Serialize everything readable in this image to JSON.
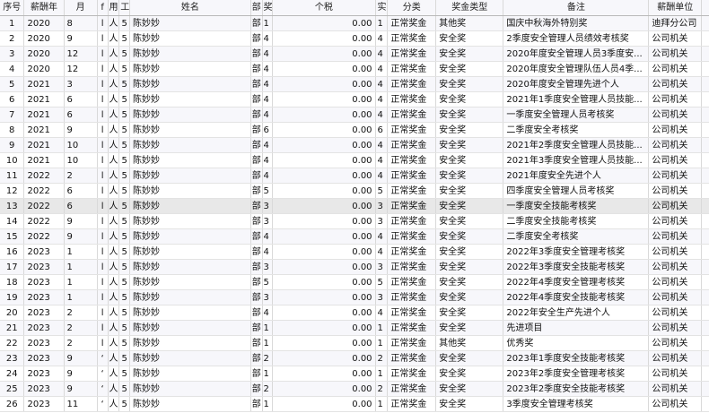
{
  "headers": [
    "序号",
    "薪酬年",
    "月",
    "f",
    "用",
    "工",
    "姓名",
    "部",
    "奖",
    "个税",
    "实",
    "分类",
    "奖金类型",
    "备注",
    "薪酬单位"
  ],
  "rows": [
    [
      "1",
      "2020",
      "8",
      "l",
      "人",
      "5",
      "陈妙妙",
      "部",
      "1",
      "0.00",
      "1",
      "正常奖金",
      "其他奖",
      "国庆中秋海外特别奖",
      "迪拜分公司"
    ],
    [
      "2",
      "2020",
      "9",
      "l",
      "人",
      "5",
      "陈妙妙",
      "部",
      "4",
      "0.00",
      "4",
      "正常奖金",
      "安全奖",
      "2季度安全管理人员绩效考核奖",
      "公司机关"
    ],
    [
      "3",
      "2020",
      "12",
      "l",
      "人",
      "5",
      "陈妙妙",
      "部",
      "4",
      "0.00",
      "4",
      "正常奖金",
      "安全奖",
      "2020年度安全管理人员3季度安...",
      "公司机关"
    ],
    [
      "4",
      "2020",
      "12",
      "l",
      "人",
      "5",
      "陈妙妙",
      "部",
      "4",
      "0.00",
      "4",
      "正常奖金",
      "安全奖",
      "2020年度安全管理队伍人员4季...",
      "公司机关"
    ],
    [
      "5",
      "2021",
      "3",
      "l",
      "人",
      "5",
      "陈妙妙",
      "部",
      "4",
      "0.00",
      "4",
      "正常奖金",
      "安全奖",
      "2020年度安全管理先进个人",
      "公司机关"
    ],
    [
      "6",
      "2021",
      "6",
      "l",
      "人",
      "5",
      "陈妙妙",
      "部",
      "4",
      "0.00",
      "4",
      "正常奖金",
      "安全奖",
      "2021年1季度安全管理人员技能...",
      "公司机关"
    ],
    [
      "7",
      "2021",
      "6",
      "l",
      "人",
      "5",
      "陈妙妙",
      "部",
      "4",
      "0.00",
      "4",
      "正常奖金",
      "安全奖",
      "一季度安全管理人员考核奖",
      "公司机关"
    ],
    [
      "8",
      "2021",
      "9",
      "l",
      "人",
      "5",
      "陈妙妙",
      "部",
      "6",
      "0.00",
      "6",
      "正常奖金",
      "安全奖",
      "二季度安全考核奖",
      "公司机关"
    ],
    [
      "9",
      "2021",
      "10",
      "l",
      "人",
      "5",
      "陈妙妙",
      "部",
      "4",
      "0.00",
      "4",
      "正常奖金",
      "安全奖",
      "2021年2季度安全管理人员技能...",
      "公司机关"
    ],
    [
      "10",
      "2021",
      "10",
      "l",
      "人",
      "5",
      "陈妙妙",
      "部",
      "4",
      "0.00",
      "4",
      "正常奖金",
      "安全奖",
      "2021年3季度安全管理人员技能...",
      "公司机关"
    ],
    [
      "11",
      "2022",
      "2",
      "l",
      "人",
      "5",
      "陈妙妙",
      "部",
      "4",
      "0.00",
      "4",
      "正常奖金",
      "安全奖",
      "2021年度安全先进个人",
      "公司机关"
    ],
    [
      "12",
      "2022",
      "6",
      "l",
      "人",
      "5",
      "陈妙妙",
      "部",
      "5",
      "0.00",
      "5",
      "正常奖金",
      "安全奖",
      "四季度安全管理人员考核奖",
      "公司机关"
    ],
    [
      "13",
      "2022",
      "6",
      "l",
      "人",
      "5",
      "陈妙妙",
      "部",
      "3",
      "0.00",
      "3",
      "正常奖金",
      "安全奖",
      "一季度安全技能考核奖",
      "公司机关"
    ],
    [
      "14",
      "2022",
      "9",
      "l",
      "人",
      "5",
      "陈妙妙",
      "部",
      "3",
      "0.00",
      "3",
      "正常奖金",
      "安全奖",
      "二季度安全技能考核奖",
      "公司机关"
    ],
    [
      "15",
      "2022",
      "9",
      "l",
      "人",
      "5",
      "陈妙妙",
      "部",
      "4",
      "0.00",
      "4",
      "正常奖金",
      "安全奖",
      "二季度安全考核奖",
      "公司机关"
    ],
    [
      "16",
      "2023",
      "1",
      "l",
      "人",
      "5",
      "陈妙妙",
      "部",
      "4",
      "0.00",
      "4",
      "正常奖金",
      "安全奖",
      "2022年3季度安全管理考核奖",
      "公司机关"
    ],
    [
      "17",
      "2023",
      "1",
      "l",
      "人",
      "5",
      "陈妙妙",
      "部",
      "3",
      "0.00",
      "3",
      "正常奖金",
      "安全奖",
      "2022年3季度安全技能考核奖",
      "公司机关"
    ],
    [
      "18",
      "2023",
      "1",
      "l",
      "人",
      "5",
      "陈妙妙",
      "部",
      "5",
      "0.00",
      "5",
      "正常奖金",
      "安全奖",
      "2022年4季度安全管理考核奖",
      "公司机关"
    ],
    [
      "19",
      "2023",
      "1",
      "l",
      "人",
      "5",
      "陈妙妙",
      "部",
      "3",
      "0.00",
      "3",
      "正常奖金",
      "安全奖",
      "2022年4季度安全技能考核奖",
      "公司机关"
    ],
    [
      "20",
      "2023",
      "2",
      "l",
      "人",
      "5",
      "陈妙妙",
      "部",
      "4",
      "0.00",
      "4",
      "正常奖金",
      "安全奖",
      "2022年安全生产先进个人",
      "公司机关"
    ],
    [
      "21",
      "2023",
      "2",
      "l",
      "人",
      "5",
      "陈妙妙",
      "部",
      "1",
      "0.00",
      "1",
      "正常奖金",
      "安全奖",
      "先进项目",
      "公司机关"
    ],
    [
      "22",
      "2023",
      "2",
      "l",
      "人",
      "5",
      "陈妙妙",
      "部",
      "1",
      "0.00",
      "1",
      "正常奖金",
      "其他奖",
      "优秀奖",
      "公司机关"
    ],
    [
      "23",
      "2023",
      "9",
      "‘",
      "人",
      "5",
      "陈妙妙",
      "部",
      "2",
      "0.00",
      "2",
      "正常奖金",
      "安全奖",
      "2023年1季度安全技能考核奖",
      "公司机关"
    ],
    [
      "24",
      "2023",
      "9",
      "‘",
      "人",
      "5",
      "陈妙妙",
      "部",
      "1",
      "0.00",
      "1",
      "正常奖金",
      "安全奖",
      "2023年2季度安全管理考核奖",
      "公司机关"
    ],
    [
      "25",
      "2023",
      "9",
      "‘",
      "人",
      "5",
      "陈妙妙",
      "部",
      "2",
      "0.00",
      "2",
      "正常奖金",
      "安全奖",
      "2023年2季度安全技能考核奖",
      "公司机关"
    ],
    [
      "26",
      "2023",
      "11",
      "‘",
      "人",
      "5",
      "陈妙妙",
      "部",
      "1",
      "0.00",
      "1",
      "正常奖金",
      "安全奖",
      "3季度安全管理考核奖",
      "公司机关"
    ]
  ]
}
